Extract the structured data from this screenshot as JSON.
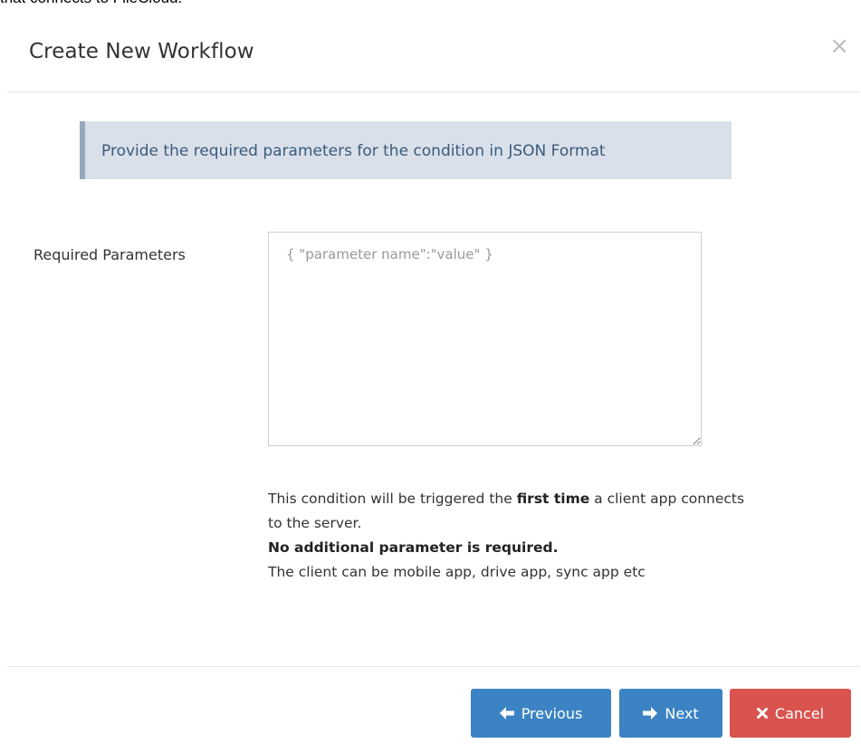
{
  "background_text": "that connects to FileCloud.",
  "modal": {
    "title": "Create New Workflow",
    "close_glyph": "×"
  },
  "info_callout": {
    "text": "Provide the required parameters for the condition in JSON Format"
  },
  "form": {
    "label": "Required Parameters",
    "placeholder": "{ \"parameter name\":\"value\" }",
    "value": ""
  },
  "help": {
    "line1_pre": "This condition will be triggered the ",
    "line1_bold": "first time",
    "line1_post": " a client app connects to the server.",
    "line2_bold": "No additional parameter is required.",
    "line3": "The client can be mobile app, drive app, sync app etc"
  },
  "buttons": {
    "previous_label": "Previous",
    "next_label": "Next",
    "cancel_label": "Cancel"
  },
  "icons": {
    "previous": "arrow-left-icon",
    "next": "arrow-right-icon",
    "cancel": "x-mark-icon"
  },
  "colors": {
    "primary": "#3c83c3",
    "danger": "#d9534f",
    "callout_bg": "#d9e0e9",
    "callout_border": "#97a8bb",
    "callout_text": "#3a5a7c"
  }
}
